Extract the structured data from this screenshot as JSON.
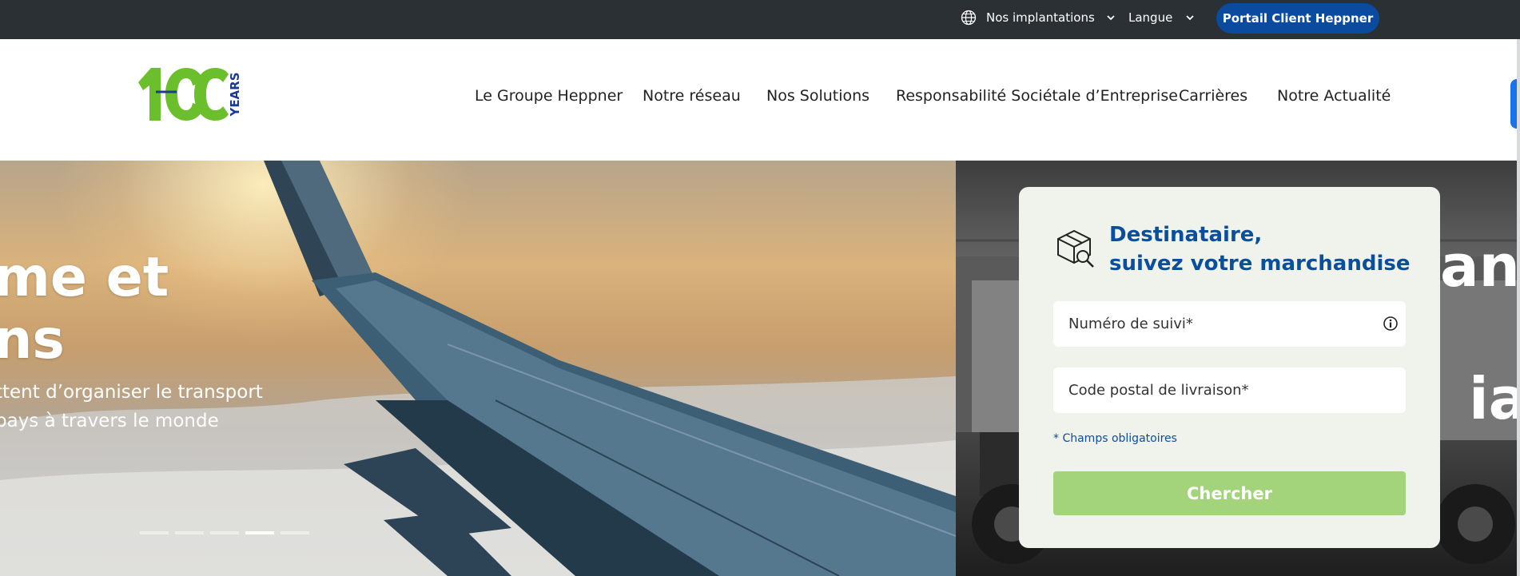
{
  "topbar": {
    "locations_label": "Nos implantations",
    "language_label": "Langue",
    "portal_button": "Portail Client Heppner"
  },
  "logo": {
    "number": "100",
    "years": "YEARS"
  },
  "nav": {
    "items": [
      "Le Groupe Heppner",
      "Notre réseau",
      "Nos Solutions",
      "Responsabilité Sociétale d’Entreprise",
      "Carrières",
      "Notre Actualité"
    ]
  },
  "hero": {
    "title": "me et\nns",
    "subtitle": "ttent d’organiser le transport\npays à travers le monde",
    "slide_b_line1": "ans",
    "slide_b_line2": "iale",
    "active_dot": 4,
    "dot_count": 5
  },
  "tracking": {
    "title": "Destinataire,\nsuivez votre marchandise",
    "tracking_placeholder": "Numéro de suivi*",
    "postal_placeholder": "Code postal de livraison*",
    "required_note": "* Champs obligatoires",
    "search_button": "Chercher"
  },
  "colors": {
    "topbar_bg": "#2b3035",
    "brand_blue": "#0a4a9f",
    "brand_green": "#6cbf2c",
    "button_green": "#a3d47c"
  },
  "icons": {
    "globe": "globe-icon",
    "chevron": "chevron-down-icon",
    "package_search": "package-search-icon",
    "info": "info-icon"
  }
}
